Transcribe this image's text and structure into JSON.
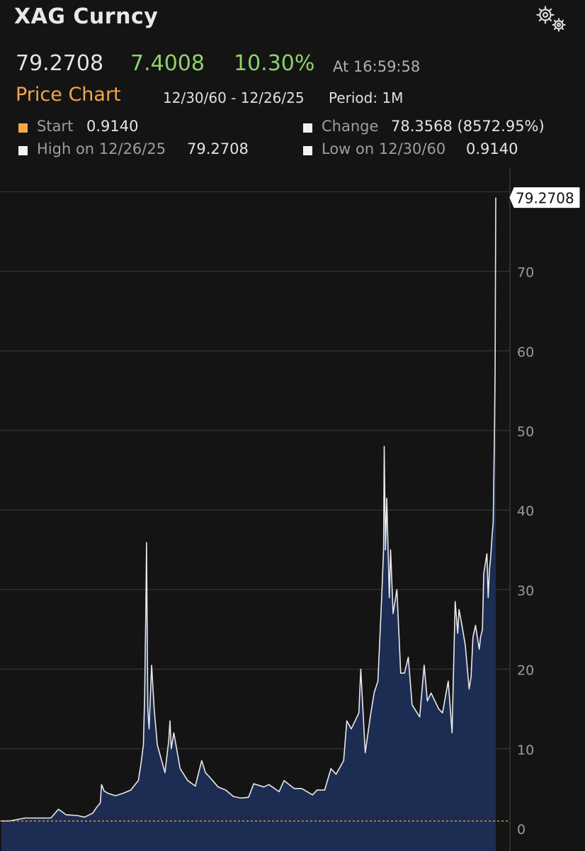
{
  "header": {
    "title": "XAG Curncy"
  },
  "quote": {
    "last": "79.2708",
    "net_change": "7.4008",
    "pct_change": "10.30%",
    "as_of": "At 16:59:58"
  },
  "chart_header": {
    "title": "Price Chart",
    "date_range": "12/30/60 - 12/26/25",
    "period": "Period: 1M"
  },
  "legend": {
    "start_label": "Start",
    "start_value": "0.9140",
    "change_label": "Change",
    "change_value": "78.3568 (8572.95%)",
    "high_label": "High on 12/26/25",
    "high_value": "79.2708",
    "low_label": "Low on 12/30/60",
    "low_value": "0.9140"
  },
  "icons": {
    "settings": "gear-icon"
  },
  "colors": {
    "background": "#141414",
    "accent": "#f0a84a",
    "positive": "#8ed16b",
    "line": "#e8e8e8",
    "area_fill": "#1d2c52",
    "grid": "#3a3a3a",
    "axis_text": "#9a9a9a",
    "start_ref": "#f0a84a"
  },
  "chart_data": {
    "type": "area",
    "x_start": "1960-12",
    "x_end": "2025-12",
    "ylim": [
      0,
      80
    ],
    "yticks": [
      "0",
      "10",
      "20",
      "30",
      "40",
      "50",
      "60",
      "70",
      "80"
    ],
    "start_reference": 0.914,
    "last_value_label": "79.2708",
    "grid": true,
    "series": [
      {
        "x": [
          "1960-12",
          "1962-01",
          "1964-01",
          "1966-01",
          "1967-06",
          "1968-06",
          "1969-06",
          "1970-12",
          "1971-11",
          "1972-12",
          "1973-06",
          "1973-12",
          "1974-02",
          "1974-06",
          "1974-12",
          "1975-12",
          "1976-12",
          "1977-12",
          "1978-06",
          "1978-12",
          "1979-04",
          "1979-08",
          "1979-10",
          "1979-12",
          "1980-01",
          "1980-03",
          "1980-05",
          "1980-09",
          "1981-01",
          "1981-06",
          "1982-06",
          "1982-12",
          "1983-02",
          "1983-04",
          "1983-08",
          "1984-06",
          "1985-06",
          "1986-06",
          "1987-04",
          "1987-10",
          "1988-06",
          "1989-06",
          "1990-06",
          "1991-06",
          "1992-06",
          "1993-06",
          "1994-02",
          "1995-06",
          "1996-02",
          "1997-06",
          "1998-02",
          "1999-06",
          "2000-06",
          "2001-11",
          "2002-06",
          "2003-06",
          "2004-04",
          "2004-12",
          "2005-12",
          "2006-05",
          "2006-12",
          "2007-12",
          "2008-03",
          "2008-10",
          "2009-06",
          "2009-12",
          "2010-06",
          "2010-12",
          "2011-03",
          "2011-04",
          "2011-06",
          "2011-08",
          "2011-12",
          "2012-02",
          "2012-06",
          "2012-12",
          "2013-06",
          "2013-12",
          "2014-06",
          "2014-12",
          "2015-12",
          "2016-07",
          "2016-12",
          "2017-06",
          "2018-06",
          "2018-12",
          "2019-09",
          "2020-03",
          "2020-05",
          "2020-08",
          "2020-12",
          "2021-02",
          "2021-06",
          "2021-12",
          "2022-06",
          "2022-09",
          "2022-12",
          "2023-04",
          "2023-10",
          "2023-12",
          "2024-03",
          "2024-05",
          "2024-10",
          "2024-12",
          "2025-02",
          "2025-04",
          "2025-06",
          "2025-08",
          "2025-10",
          "2025-11",
          "2025-12"
        ],
        "values": [
          0.914,
          0.93,
          1.29,
          1.29,
          1.29,
          2.4,
          1.7,
          1.6,
          1.4,
          1.9,
          2.6,
          3.2,
          5.5,
          4.7,
          4.4,
          4.1,
          4.4,
          4.8,
          5.4,
          6.0,
          8.0,
          10.5,
          16.5,
          28.0,
          35.9,
          15.0,
          12.5,
          20.5,
          15.0,
          10.5,
          7.0,
          11.0,
          13.5,
          10.0,
          12.0,
          7.5,
          6.0,
          5.3,
          8.5,
          7.0,
          6.3,
          5.2,
          4.8,
          4.0,
          3.8,
          3.9,
          5.6,
          5.2,
          5.5,
          4.6,
          6.0,
          5.0,
          5.0,
          4.2,
          4.8,
          4.8,
          7.5,
          6.8,
          8.5,
          13.5,
          12.5,
          14.5,
          20.0,
          9.5,
          14.0,
          17.0,
          18.5,
          29.0,
          35.0,
          48.0,
          35.0,
          41.5,
          29.0,
          35.0,
          27.0,
          30.0,
          19.5,
          19.5,
          21.5,
          15.5,
          14.0,
          20.5,
          16.0,
          17.0,
          15.0,
          14.5,
          18.5,
          12.0,
          18.5,
          28.5,
          24.5,
          27.5,
          25.8,
          23.0,
          17.5,
          19.0,
          24.0,
          25.5,
          22.5,
          24.0,
          25.0,
          32.0,
          34.5,
          29.0,
          32.5,
          34.0,
          36.5,
          38.5,
          50.0,
          58.0,
          79.27
        ]
      }
    ]
  }
}
